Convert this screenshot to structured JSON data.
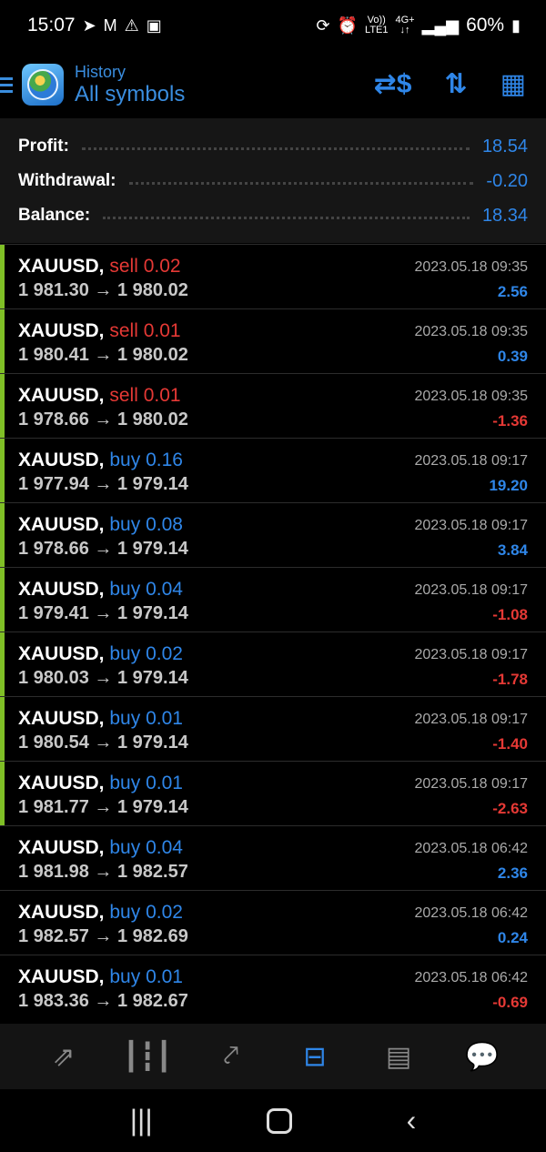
{
  "status_bar": {
    "time": "15:07",
    "battery": "60%",
    "net1": "Vo))",
    "net1b": "LTE1",
    "net2": "4G+",
    "left_icons": [
      "telegram-icon",
      "gmail-icon",
      "warning-icon",
      "image-icon"
    ],
    "right_icons": [
      "sync-icon",
      "alarm-icon",
      "volte-icon",
      "4g-icon",
      "signal-icon",
      "battery-icon"
    ]
  },
  "header": {
    "subtitle": "History",
    "title": "All symbols",
    "actions": [
      "deposit-withdraw-icon",
      "sort-icon",
      "calendar-icon"
    ]
  },
  "summary": [
    {
      "label": "Profit:",
      "value": "18.54"
    },
    {
      "label": "Withdrawal:",
      "value": "-0.20"
    },
    {
      "label": "Balance:",
      "value": "18.34"
    }
  ],
  "trades": [
    {
      "symbol": "XAUUSD,",
      "side": "sell",
      "volume": "0.02",
      "prices": "1 981.30 → 1 980.02",
      "date": "2023.05.18 09:35",
      "profit": "2.56",
      "active": true
    },
    {
      "symbol": "XAUUSD,",
      "side": "sell",
      "volume": "0.01",
      "prices": "1 980.41 → 1 980.02",
      "date": "2023.05.18 09:35",
      "profit": "0.39",
      "active": true
    },
    {
      "symbol": "XAUUSD,",
      "side": "sell",
      "volume": "0.01",
      "prices": "1 978.66 → 1 980.02",
      "date": "2023.05.18 09:35",
      "profit": "-1.36",
      "active": true
    },
    {
      "symbol": "XAUUSD,",
      "side": "buy",
      "volume": "0.16",
      "prices": "1 977.94 → 1 979.14",
      "date": "2023.05.18 09:17",
      "profit": "19.20",
      "active": true
    },
    {
      "symbol": "XAUUSD,",
      "side": "buy",
      "volume": "0.08",
      "prices": "1 978.66 → 1 979.14",
      "date": "2023.05.18 09:17",
      "profit": "3.84",
      "active": true
    },
    {
      "symbol": "XAUUSD,",
      "side": "buy",
      "volume": "0.04",
      "prices": "1 979.41 → 1 979.14",
      "date": "2023.05.18 09:17",
      "profit": "-1.08",
      "active": true
    },
    {
      "symbol": "XAUUSD,",
      "side": "buy",
      "volume": "0.02",
      "prices": "1 980.03 → 1 979.14",
      "date": "2023.05.18 09:17",
      "profit": "-1.78",
      "active": true
    },
    {
      "symbol": "XAUUSD,",
      "side": "buy",
      "volume": "0.01",
      "prices": "1 980.54 → 1 979.14",
      "date": "2023.05.18 09:17",
      "profit": "-1.40",
      "active": true
    },
    {
      "symbol": "XAUUSD,",
      "side": "buy",
      "volume": "0.01",
      "prices": "1 981.77 → 1 979.14",
      "date": "2023.05.18 09:17",
      "profit": "-2.63",
      "active": true
    },
    {
      "symbol": "XAUUSD,",
      "side": "buy",
      "volume": "0.04",
      "prices": "1 981.98 → 1 982.57",
      "date": "2023.05.18 06:42",
      "profit": "2.36",
      "active": false
    },
    {
      "symbol": "XAUUSD,",
      "side": "buy",
      "volume": "0.02",
      "prices": "1 982.57 → 1 982.69",
      "date": "2023.05.18 06:42",
      "profit": "0.24",
      "active": false
    },
    {
      "symbol": "XAUUSD,",
      "side": "buy",
      "volume": "0.01",
      "prices": "1 983.36 → 1 982.67",
      "date": "2023.05.18 06:42",
      "profit": "-0.69",
      "active": false
    }
  ],
  "tabbar": {
    "tabs": [
      "quotes-icon",
      "chart-icon",
      "trade-icon",
      "history-icon",
      "news-icon",
      "chat-icon"
    ],
    "selected": "history-icon"
  },
  "navbar": [
    "recent-apps-icon",
    "home-icon",
    "back-icon"
  ],
  "colors": {
    "accent": "#2f86e8",
    "sell": "#e53935",
    "marker": "#7fbf26"
  }
}
